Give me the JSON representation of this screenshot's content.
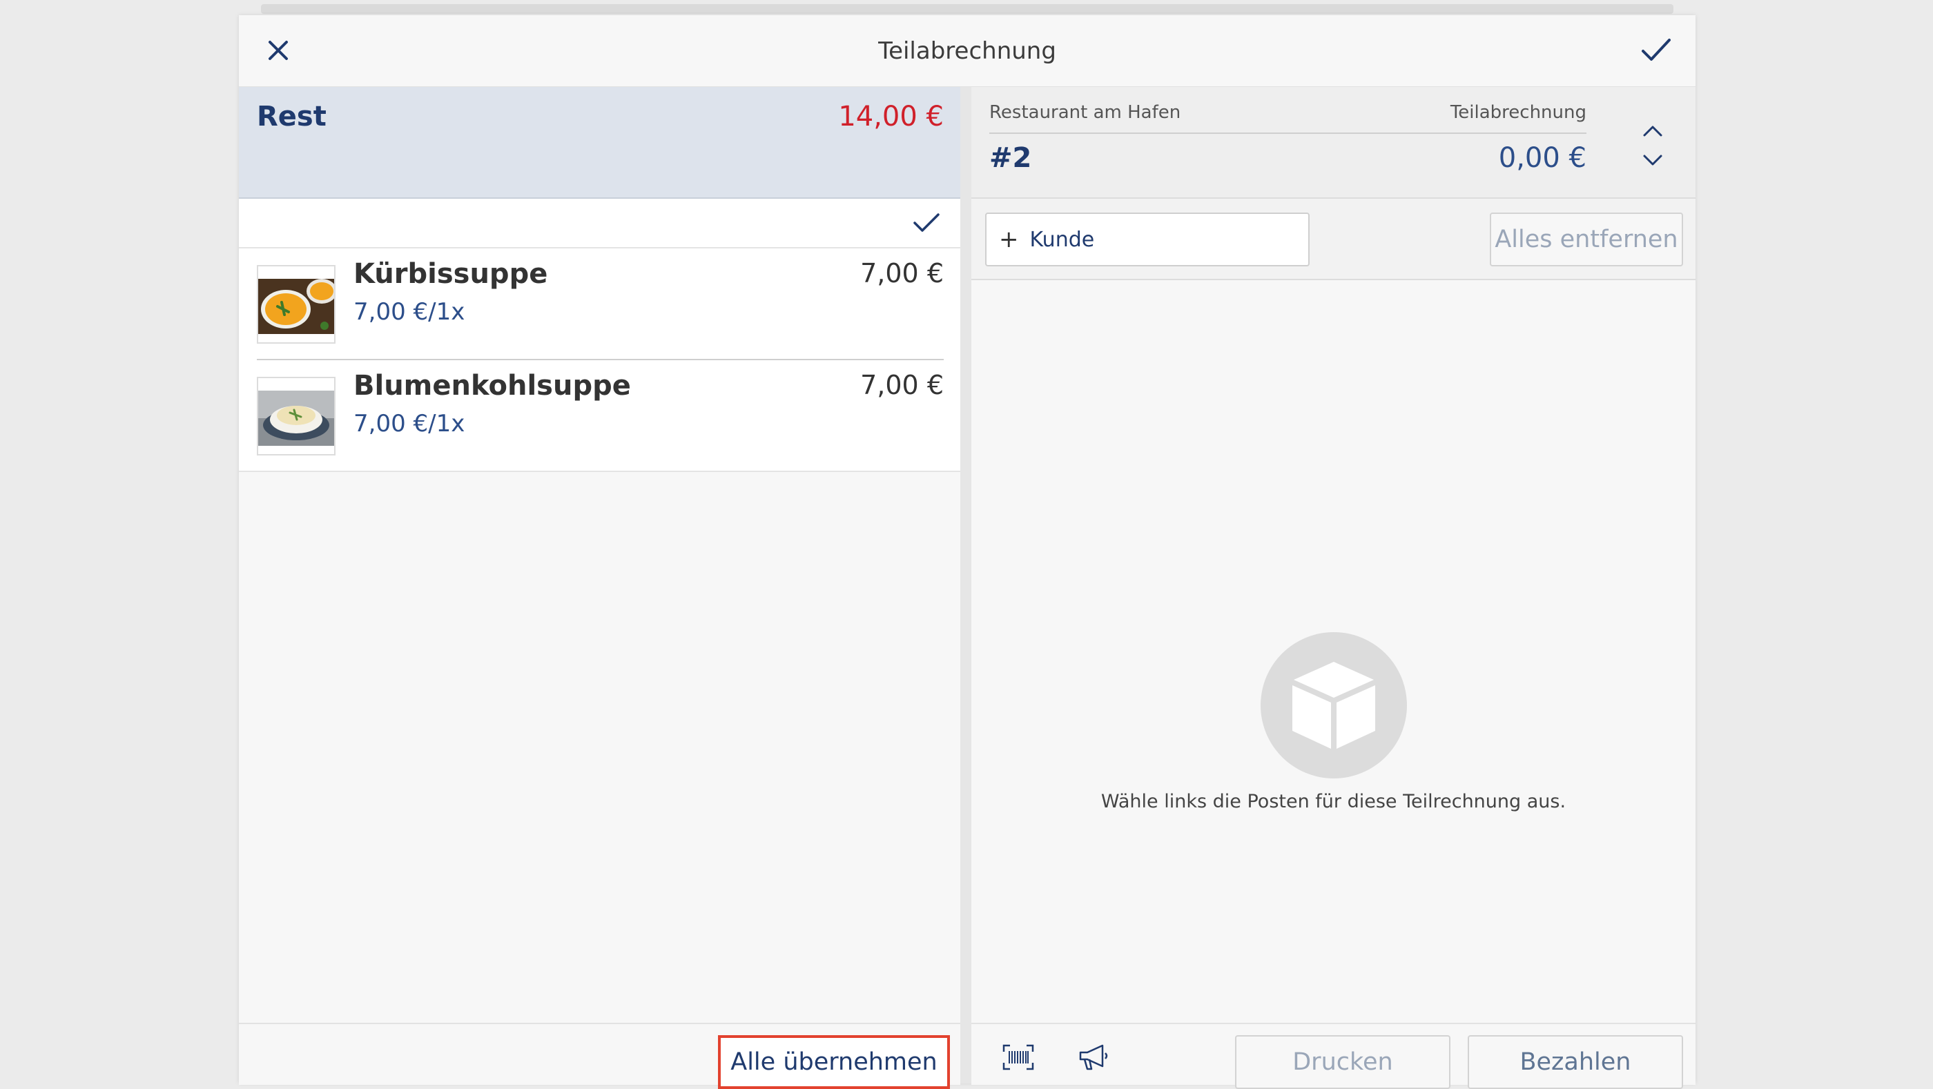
{
  "dialog": {
    "title": "Teilabrechnung",
    "close_icon": "close-icon",
    "confirm_icon": "checkmark-icon"
  },
  "left": {
    "rest_label": "Rest",
    "rest_amount": "14,00 €",
    "items": [
      {
        "name": "Kürbissuppe",
        "unit_price": "7,00 €/1x",
        "price": "7,00 €",
        "image": "pumpkin-soup-photo"
      },
      {
        "name": "Blumenkohlsuppe",
        "unit_price": "7,00 €/1x",
        "price": "7,00 €",
        "image": "cauliflower-soup-photo"
      }
    ],
    "take_all_label": "Alle übernehmen"
  },
  "right": {
    "restaurant": "Restaurant am Hafen",
    "receipt_type": "Teilabrechnung",
    "receipt_number": "#2",
    "receipt_amount": "0,00 €",
    "customer_plus": "+",
    "customer_label": "Kunde",
    "remove_all_label": "Alles entfernen",
    "empty_text": "Wähle links die Posten für diese Teilrechnung aus.",
    "print_label": "Drucken",
    "pay_label": "Bezahlen"
  },
  "colors": {
    "accent": "#1f3a6e",
    "rest_amount": "#d0202a",
    "highlight_border": "#e2422f",
    "disabled_text": "#9aa6b8"
  }
}
